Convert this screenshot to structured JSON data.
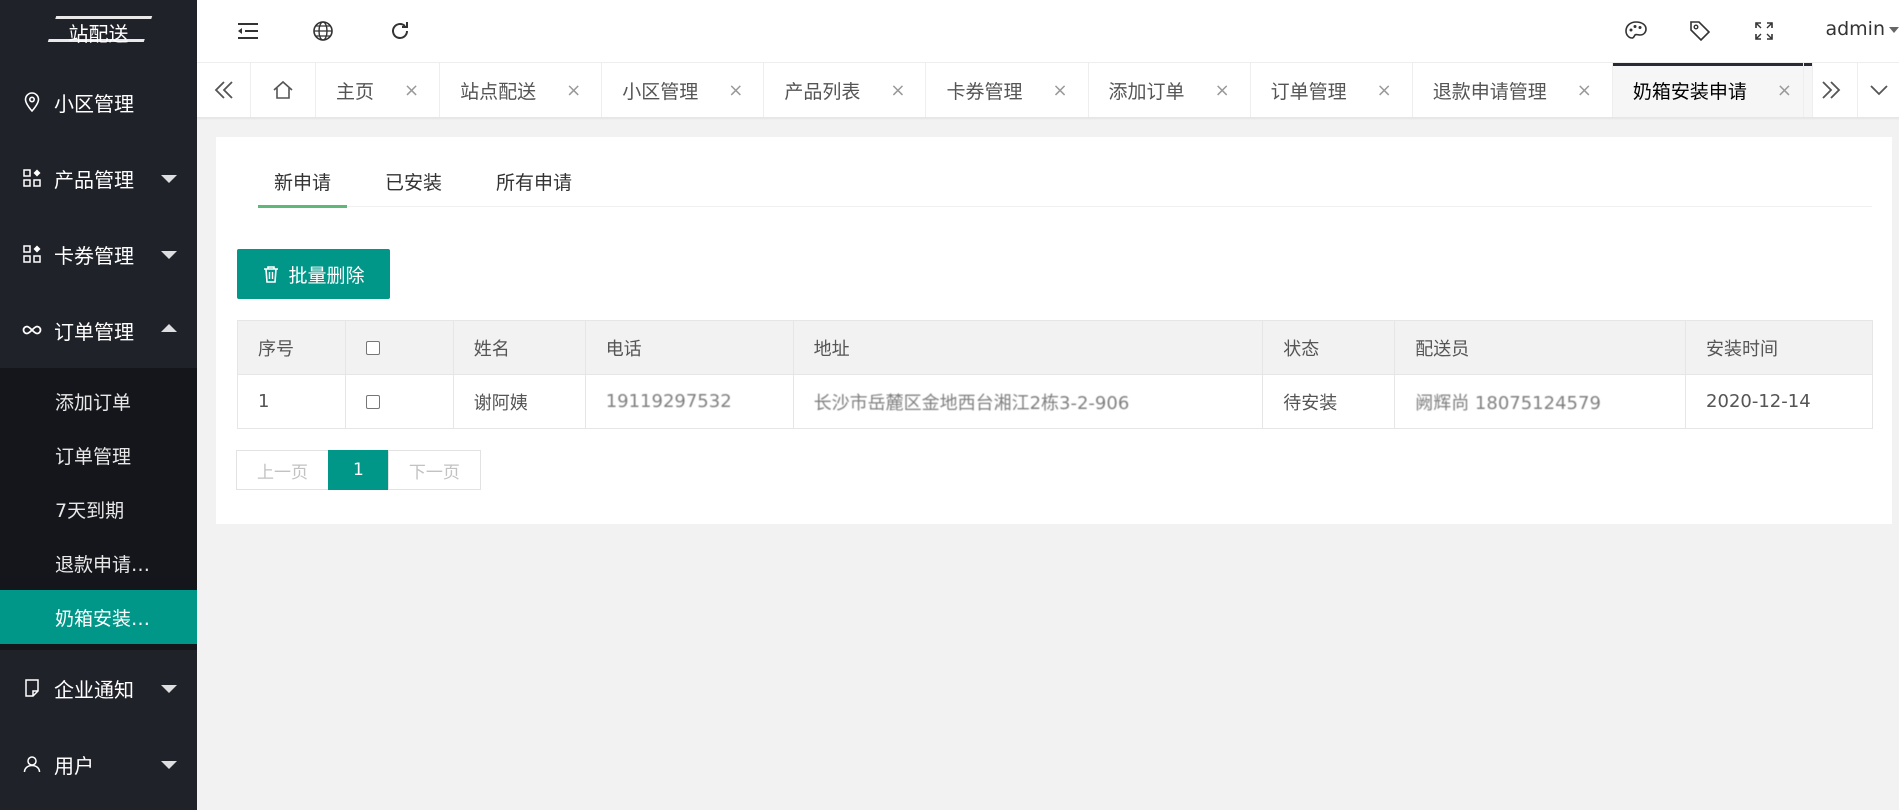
{
  "colors": {
    "sidebar_bg": "#20222a",
    "accent": "#009688",
    "active_tab_line": "#5fb878"
  },
  "sidebar": {
    "logo_text": "站配送",
    "items": [
      {
        "label": "小区管理",
        "icon": "location-icon"
      },
      {
        "label": "产品管理",
        "icon": "apps-icon"
      },
      {
        "label": "卡券管理",
        "icon": "apps-icon"
      },
      {
        "label": "订单管理",
        "icon": "infinity-icon",
        "expanded": true,
        "children": [
          "添加订单",
          "订单管理",
          "7天到期",
          "退款申请…",
          "奶箱安装…"
        ]
      },
      {
        "label": "企业通知",
        "icon": "note-icon"
      },
      {
        "label": "用户",
        "icon": "user-icon"
      }
    ]
  },
  "header": {
    "user": "admin"
  },
  "tabs": [
    "主页",
    "站点配送",
    "小区管理",
    "产品列表",
    "卡券管理",
    "添加订单",
    "订单管理",
    "退款申请管理",
    "奶箱安装申请"
  ],
  "content": {
    "sub_tabs": [
      "新申请",
      "已安装",
      "所有申请"
    ],
    "batch_delete": "批量删除",
    "table": {
      "headers": [
        "序号",
        "",
        "姓名",
        "电话",
        "地址",
        "状态",
        "配送员",
        "安装时间"
      ],
      "rows": [
        {
          "index": "1",
          "name": "谢阿姨",
          "phone": "19119297532",
          "address": "长沙市岳麓区金地西台湘江2栋3-2-906",
          "status": "待安装",
          "courier": "阙辉尚 18075124579",
          "date": "2020-12-14"
        }
      ]
    },
    "pager": {
      "prev": "上一页",
      "page": "1",
      "next": "下一页"
    }
  }
}
